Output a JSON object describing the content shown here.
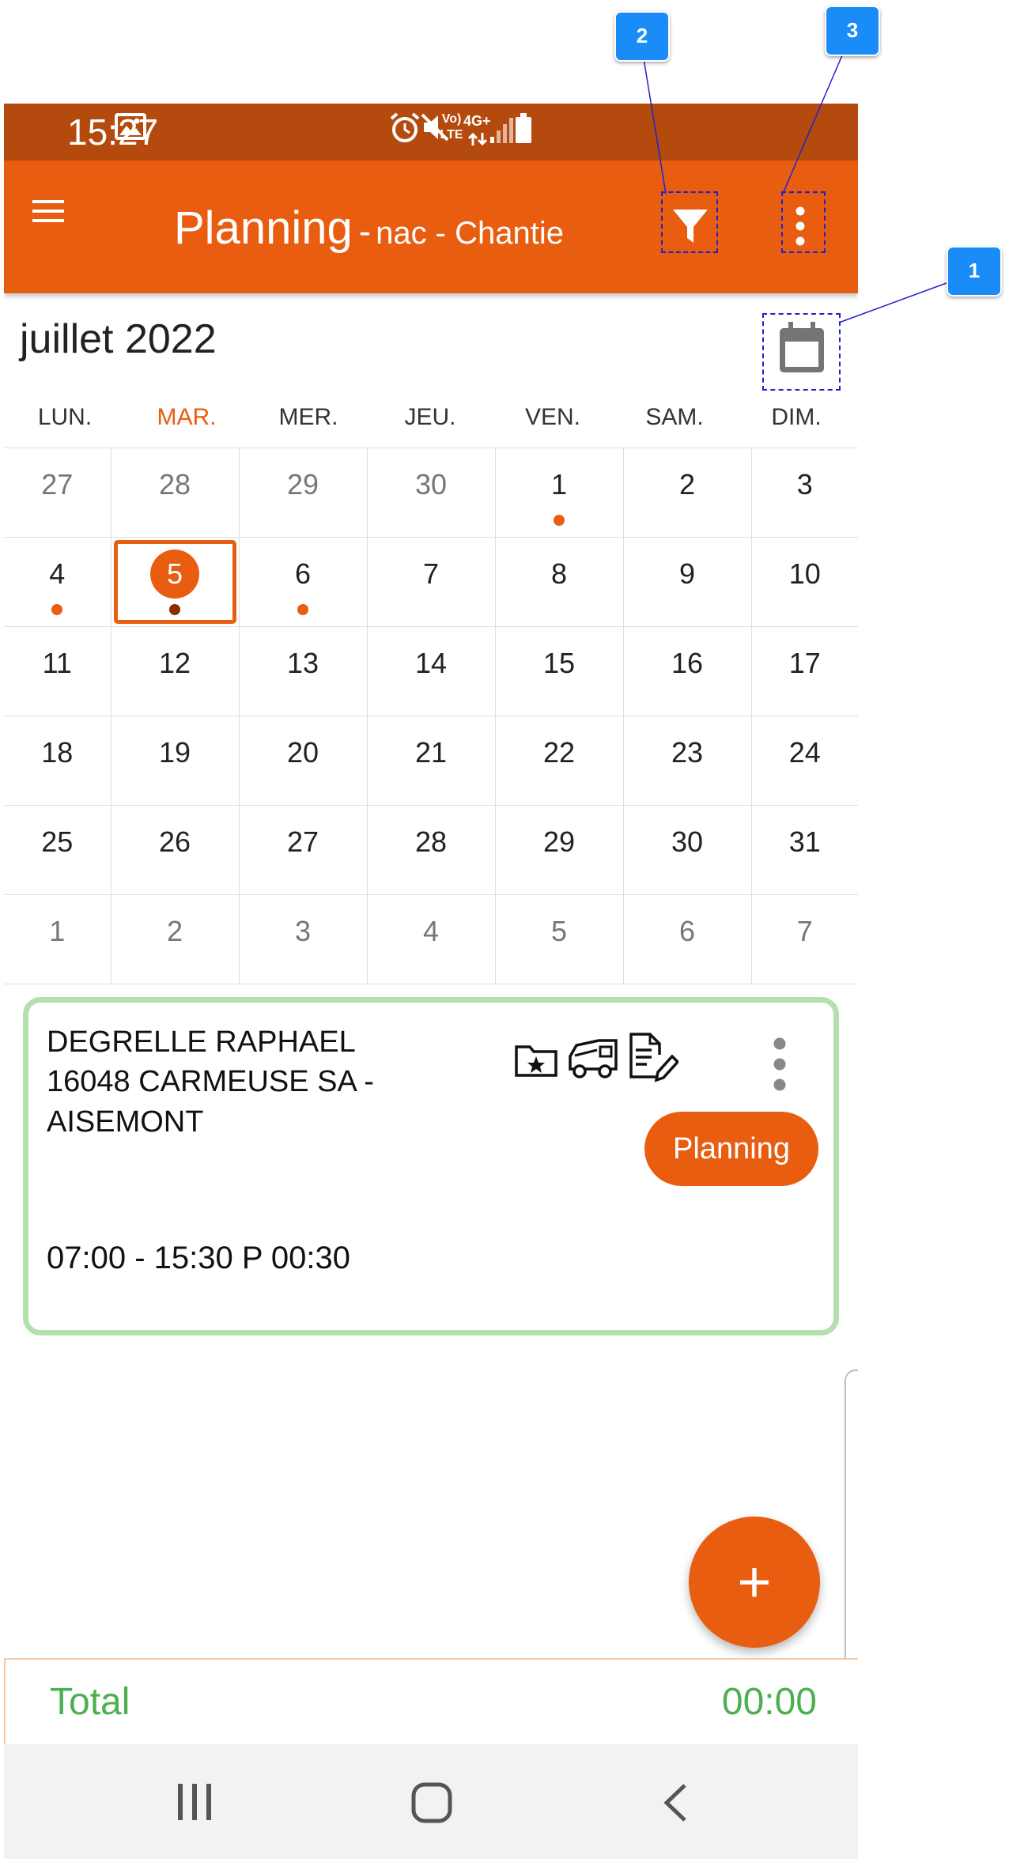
{
  "status_bar": {
    "time": "15:27",
    "network_label": "4G+",
    "volte_label": "Vo) LTE"
  },
  "app_bar": {
    "title": "Planning",
    "separator": "-",
    "subtitle": "nac - Chantie",
    "accent_color": "#e85d0f"
  },
  "calendar": {
    "month_label": "juillet 2022",
    "weekdays": [
      "LUN.",
      "MAR.",
      "MER.",
      "JEU.",
      "VEN.",
      "SAM.",
      "DIM."
    ],
    "weeks": [
      [
        "27",
        "28",
        "29",
        "30",
        "1",
        "2",
        "3"
      ],
      [
        "4",
        "5",
        "6",
        "7",
        "8",
        "9",
        "10"
      ],
      [
        "11",
        "12",
        "13",
        "14",
        "15",
        "16",
        "17"
      ],
      [
        "18",
        "19",
        "20",
        "21",
        "22",
        "23",
        "24"
      ],
      [
        "25",
        "26",
        "27",
        "28",
        "29",
        "30",
        "31"
      ],
      [
        "1",
        "2",
        "3",
        "4",
        "5",
        "6",
        "7"
      ]
    ]
  },
  "card": {
    "line1": "DEGRELLE RAPHAEL",
    "line2": "16048 CARMEUSE SA -",
    "line3": "AISEMONT",
    "time_range": "07:00 - 15:30 P 00:30",
    "planning_button": "Planning"
  },
  "fab": {
    "label": "+"
  },
  "total": {
    "label": "Total",
    "value": "00:00",
    "color": "#4caf50"
  },
  "callouts": {
    "one": "1",
    "two": "2",
    "three": "3"
  }
}
